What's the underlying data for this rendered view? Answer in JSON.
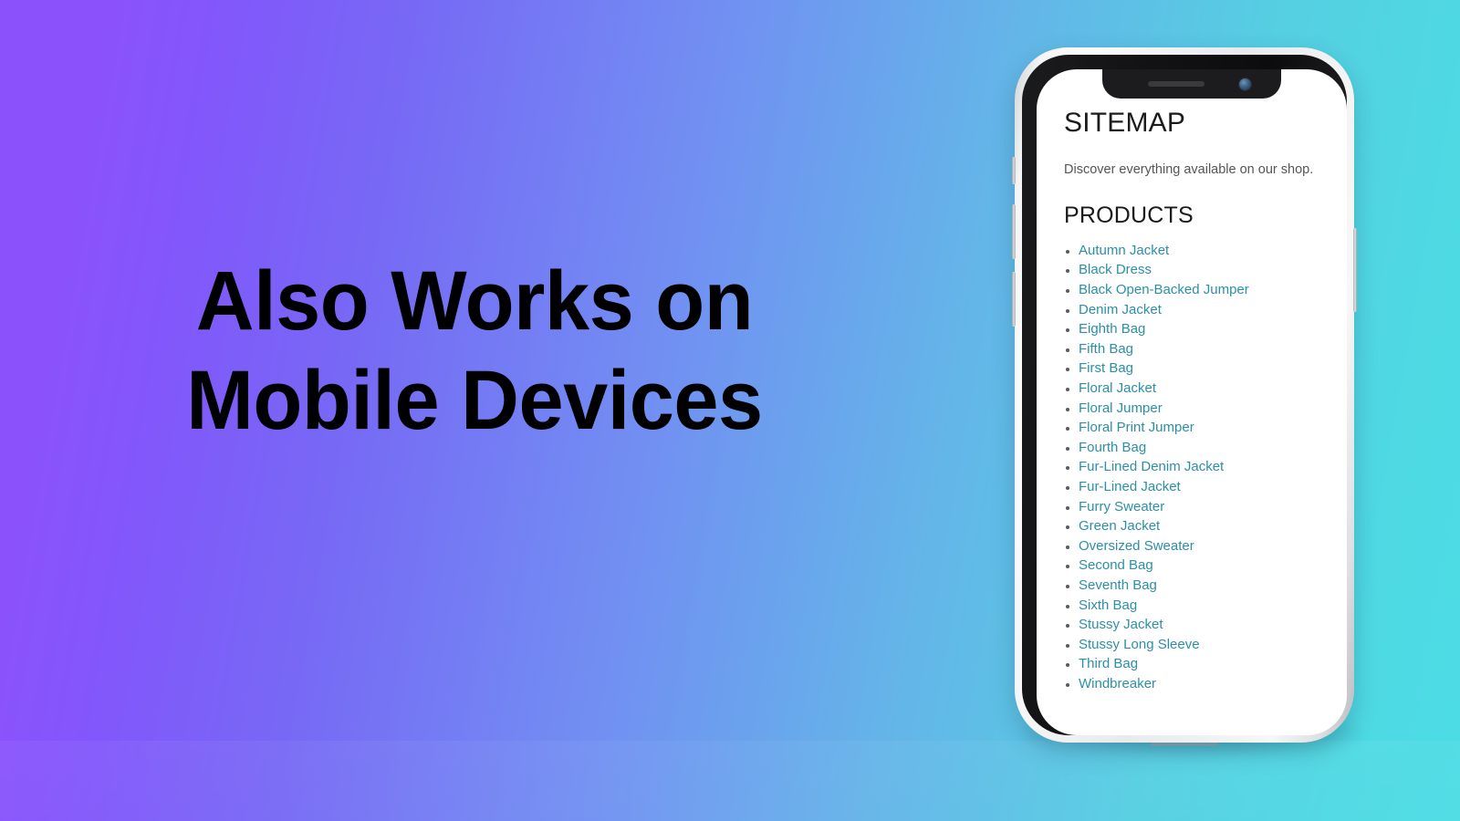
{
  "hero": {
    "headline_line1": "Also Works on",
    "headline_line2": "Mobile Devices"
  },
  "colors": {
    "gradient_start": "#8B52FB",
    "gradient_mid": "#7191F2",
    "gradient_end": "#4CDCE4",
    "headline_text": "#000000",
    "link": "#2C8FA8",
    "heading_text": "#1B1B1B",
    "subtitle_text": "#555558",
    "phone_frame": "#EAEBEC",
    "phone_bezel": "#121214",
    "screen_bg": "#FFFFFF"
  },
  "phone": {
    "notch": {
      "speaker_label": "earpiece-speaker",
      "camera_label": "front-camera"
    },
    "buttons": {
      "silent": "silent-switch",
      "volume_up": "volume-up-button",
      "volume_down": "volume-down-button",
      "power": "power-button"
    }
  },
  "page": {
    "title": "SITEMAP",
    "subtitle": "Discover everything available on our shop.",
    "section_title": "PRODUCTS",
    "products": [
      "Autumn Jacket",
      "Black Dress",
      "Black Open-Backed Jumper",
      "Denim Jacket",
      "Eighth Bag",
      "Fifth Bag",
      "First Bag",
      "Floral Jacket",
      "Floral Jumper",
      "Floral Print Jumper",
      "Fourth Bag",
      "Fur-Lined Denim Jacket",
      "Fur-Lined Jacket",
      "Furry Sweater",
      "Green Jacket",
      "Oversized Sweater",
      "Second Bag",
      "Seventh Bag",
      "Sixth Bag",
      "Stussy Jacket",
      "Stussy Long Sleeve",
      "Third Bag",
      "Windbreaker"
    ]
  }
}
